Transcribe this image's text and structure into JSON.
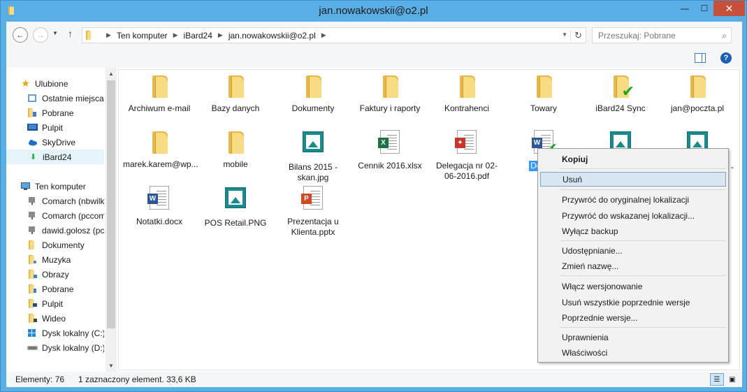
{
  "window": {
    "title": "jan.nowakowskii@o2.pl",
    "minimize": "—",
    "maximize": "☐",
    "close": "✕"
  },
  "address": {
    "crumbs": [
      "Ten komputer",
      "iBard24",
      "jan.nowakowskii@o2.pl"
    ],
    "separator": "▶",
    "dropdown": "▼",
    "refresh": "↻"
  },
  "nav_buttons": {
    "back": "←",
    "forward": "→",
    "recent": "▼",
    "up": "↑"
  },
  "search": {
    "placeholder": "Przeszukaj: Pobrane",
    "icon": "⌕"
  },
  "toolbar": {
    "help": "?"
  },
  "sidebar": {
    "favorites_label": "Ulubione",
    "favorites": [
      "Ostatnie miejsca",
      "Pobrane",
      "Pulpit",
      "SkyDrive",
      "iBard24"
    ],
    "computer_label": "Ten komputer",
    "computer": [
      "Comarch (nbwilk",
      "Comarch (pccom",
      "dawid.golosz (pc",
      "Dokumenty",
      "Muzyka",
      "Obrazy",
      "Pobrane",
      "Pulpit",
      "Wideo",
      "Dysk lokalny (C:)",
      "Dysk lokalny (D:)"
    ],
    "scroll_up": "▲",
    "scroll_down": "▼"
  },
  "files": {
    "row1": [
      "Archiwum e-mail",
      "Bazy danych",
      "Dokumenty",
      "Faktury i raporty",
      "Kontrahenci",
      "Towary",
      "iBard24 Sync",
      "jan@poczta.pl"
    ],
    "row2": [
      "marek.karem@wp...",
      "mobile",
      "Bilans 2015 - skan.jpg",
      "Cennik 2016.xlsx",
      "Delegacja nr 02-06-2016.pdf",
      "Dokum",
      "",
      "-"
    ],
    "row3": [
      "Notatki.docx",
      "POS Retail.PNG",
      "Prezentacja u Klienta.pptx"
    ],
    "badges": {
      "word": "W",
      "excel": "X",
      "pdf": "✦",
      "ppt": "P",
      "check": "✔"
    }
  },
  "context_menu": {
    "items": [
      "Kopiuj",
      "Usuń",
      "Przywróć do oryginalnej lokalizacji",
      "Przywróć do wskazanej lokalizacji...",
      "Wyłącz backup",
      "Udostępnianie...",
      "Zmień nazwę...",
      "Włącz wersjonowanie",
      "Usuń wszystkie poprzednie wersje",
      "Poprzednie wersje...",
      "Uprawnienia",
      "Właściwości"
    ]
  },
  "status": {
    "count": "Elementy: 76",
    "selection": "1 zaznaczony element. 33,6 KB",
    "view_details": "☰",
    "view_large": "▣"
  },
  "colors": {
    "window_frame": "#5aaee6",
    "close": "#c7503b",
    "selection": "#3399ff",
    "menu_highlight": "#d8e6f2",
    "folder": "#f7dc84",
    "check": "#1fa81f"
  }
}
